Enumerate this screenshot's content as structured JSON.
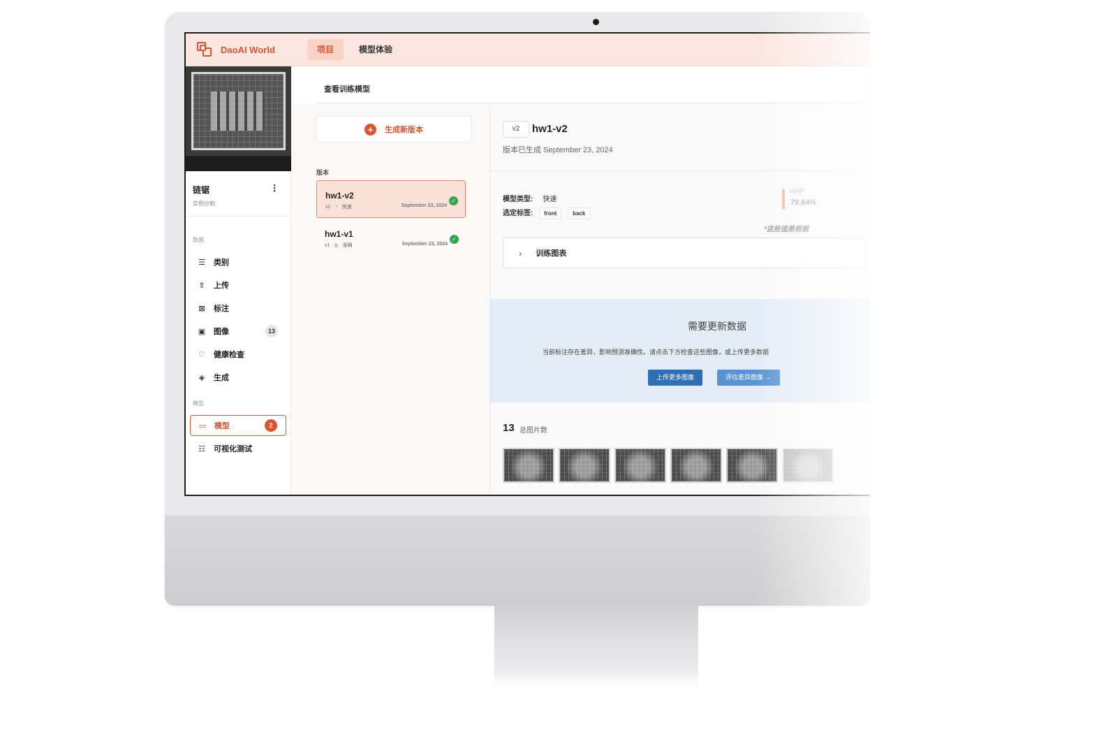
{
  "app": {
    "brand": "DaoAI World",
    "nav_tabs": [
      {
        "label": "项目",
        "active": true
      },
      {
        "label": "模型体验",
        "active": false
      }
    ]
  },
  "sidebar": {
    "project_name": "链锯",
    "project_type": "实例分割",
    "section_data": "数据",
    "section_model": "模型",
    "items": [
      {
        "label": "类别",
        "icon": "list-icon"
      },
      {
        "label": "上传",
        "icon": "upload-icon"
      },
      {
        "label": "标注",
        "icon": "annotate-icon"
      },
      {
        "label": "图像",
        "icon": "image-icon",
        "count": "13"
      },
      {
        "label": "健康检查",
        "icon": "heart-icon"
      },
      {
        "label": "生成",
        "icon": "layers-icon"
      }
    ],
    "model_items": [
      {
        "label": "模型",
        "icon": "folder-icon",
        "count": "2",
        "active": true
      },
      {
        "label": "可视化测试",
        "icon": "document-icon"
      }
    ]
  },
  "content": {
    "title": "查看训练模型",
    "generate_button": "生成新版本",
    "versions_label": "版本",
    "versions": [
      {
        "name": "hw1-v2",
        "tag": "v2",
        "mode": "快速",
        "date": "September 23, 2024",
        "active": true
      },
      {
        "name": "hw1-v1",
        "tag": "v1",
        "mode": "准确",
        "date": "September 23, 2024",
        "active": false
      }
    ]
  },
  "detail": {
    "badge": "v2",
    "name": "hw1-v2",
    "generated_on": "版本已生成 September 23, 2024",
    "model_type_label": "模型类型:",
    "model_type_value": "快速",
    "tags_label": "选定标签:",
    "tags": [
      "front",
      "back"
    ],
    "map_label": "mAP",
    "map_value": "79.64%",
    "note": "*这些值是根据",
    "training_chart_label": "训练图表",
    "alert_title": "需要更新数据",
    "alert_message": "当前标注存在差异，影响预测准确性。请点击下方检查这些图像，或上传更多数据",
    "btn_upload": "上传更多图像",
    "btn_evaluate": "评估差异图像 →",
    "image_count": "13",
    "image_count_label": "总图片数"
  },
  "colors": {
    "accent": "#d9552f",
    "nav_bg": "#fbe6e0",
    "alert_bg": "#e4ecf6",
    "primary_blue": "#2f6db5"
  }
}
